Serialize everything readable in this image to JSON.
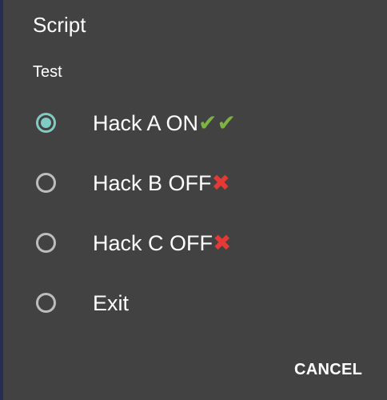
{
  "dialog": {
    "title": "Script",
    "message": "Test",
    "options": [
      {
        "label": "Hack A ON",
        "status_icon": "check-check",
        "status_text": "✔✔",
        "selected": true
      },
      {
        "label": "Hack B OFF",
        "status_icon": "cross",
        "status_text": "✖",
        "selected": false
      },
      {
        "label": "Hack C OFF",
        "status_icon": "cross",
        "status_text": "✖",
        "selected": false
      },
      {
        "label": "Exit",
        "status_icon": "",
        "status_text": "",
        "selected": false
      }
    ],
    "cancel_label": "CANCEL"
  },
  "colors": {
    "dialog_background": "#424242",
    "accent": "#80cbc4",
    "check": "#7cb342",
    "cross": "#e53935"
  }
}
